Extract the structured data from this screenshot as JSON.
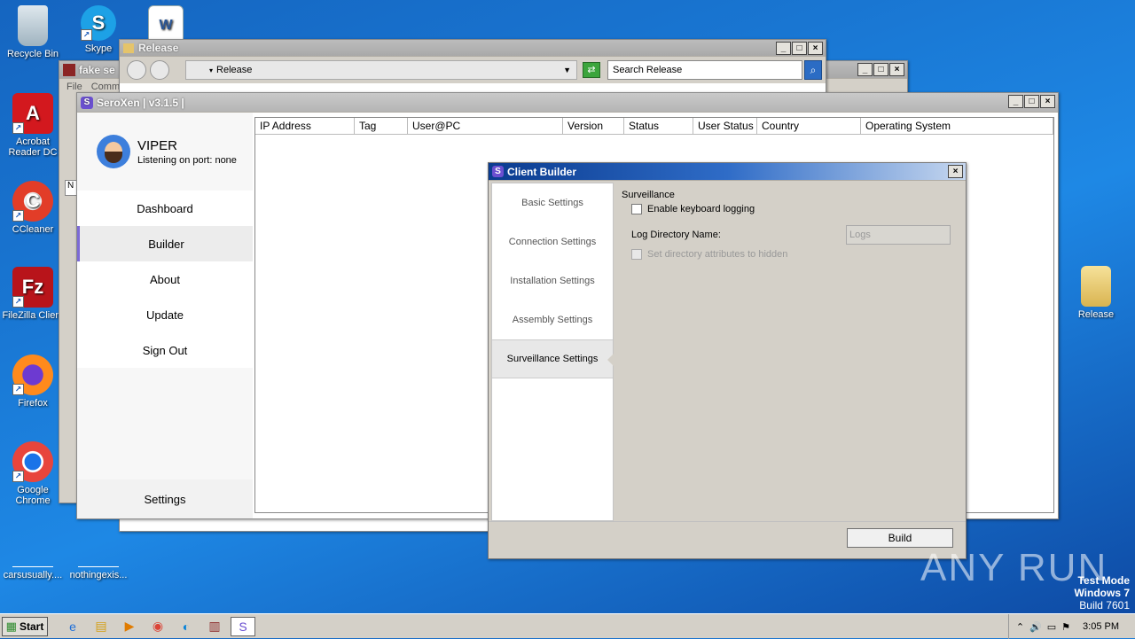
{
  "desktop": {
    "icons": {
      "recycle": "Recycle Bin",
      "skype": "Skype",
      "acrobat": "Acrobat Reader DC",
      "ccleaner": "CCleaner",
      "filezilla": "FileZilla Client",
      "firefox": "Firefox",
      "chrome": "Google Chrome",
      "carsusually": "carsusually....",
      "nothingexis": "nothingexis...",
      "release": "Release"
    },
    "watermark": {
      "brand": "ANY RUN",
      "test_mode": "Test Mode",
      "os": "Windows 7",
      "build": "Build 7601"
    }
  },
  "explorer": {
    "title": "Release",
    "path": "Release",
    "search_placeholder": "Search Release"
  },
  "fake_window": {
    "title": "fake se",
    "menu_file": "File",
    "menu_comm": "Comm",
    "col_n": "N"
  },
  "seroxen": {
    "title": "SeroXen | v3.1.5 |",
    "user": "VIPER",
    "port": "Listening on port: none",
    "nav": [
      "Dashboard",
      "Builder",
      "About",
      "Update",
      "Sign Out"
    ],
    "settings": "Settings",
    "columns": [
      "IP Address",
      "Tag",
      "User@PC",
      "Version",
      "Status",
      "User Status",
      "Country",
      "Operating System"
    ]
  },
  "builder": {
    "title": "Client Builder",
    "nav": [
      "Basic Settings",
      "Connection Settings",
      "Installation Settings",
      "Assembly Settings",
      "Surveillance Settings"
    ],
    "section": "Surveillance",
    "keylog_label": "Enable keyboard logging",
    "logdir_label": "Log Directory Name:",
    "logdir_value": "Logs",
    "hidden_label": "Set directory attributes to hidden",
    "build_button": "Build"
  },
  "taskbar": {
    "start": "Start",
    "clock": "3:05 PM"
  }
}
